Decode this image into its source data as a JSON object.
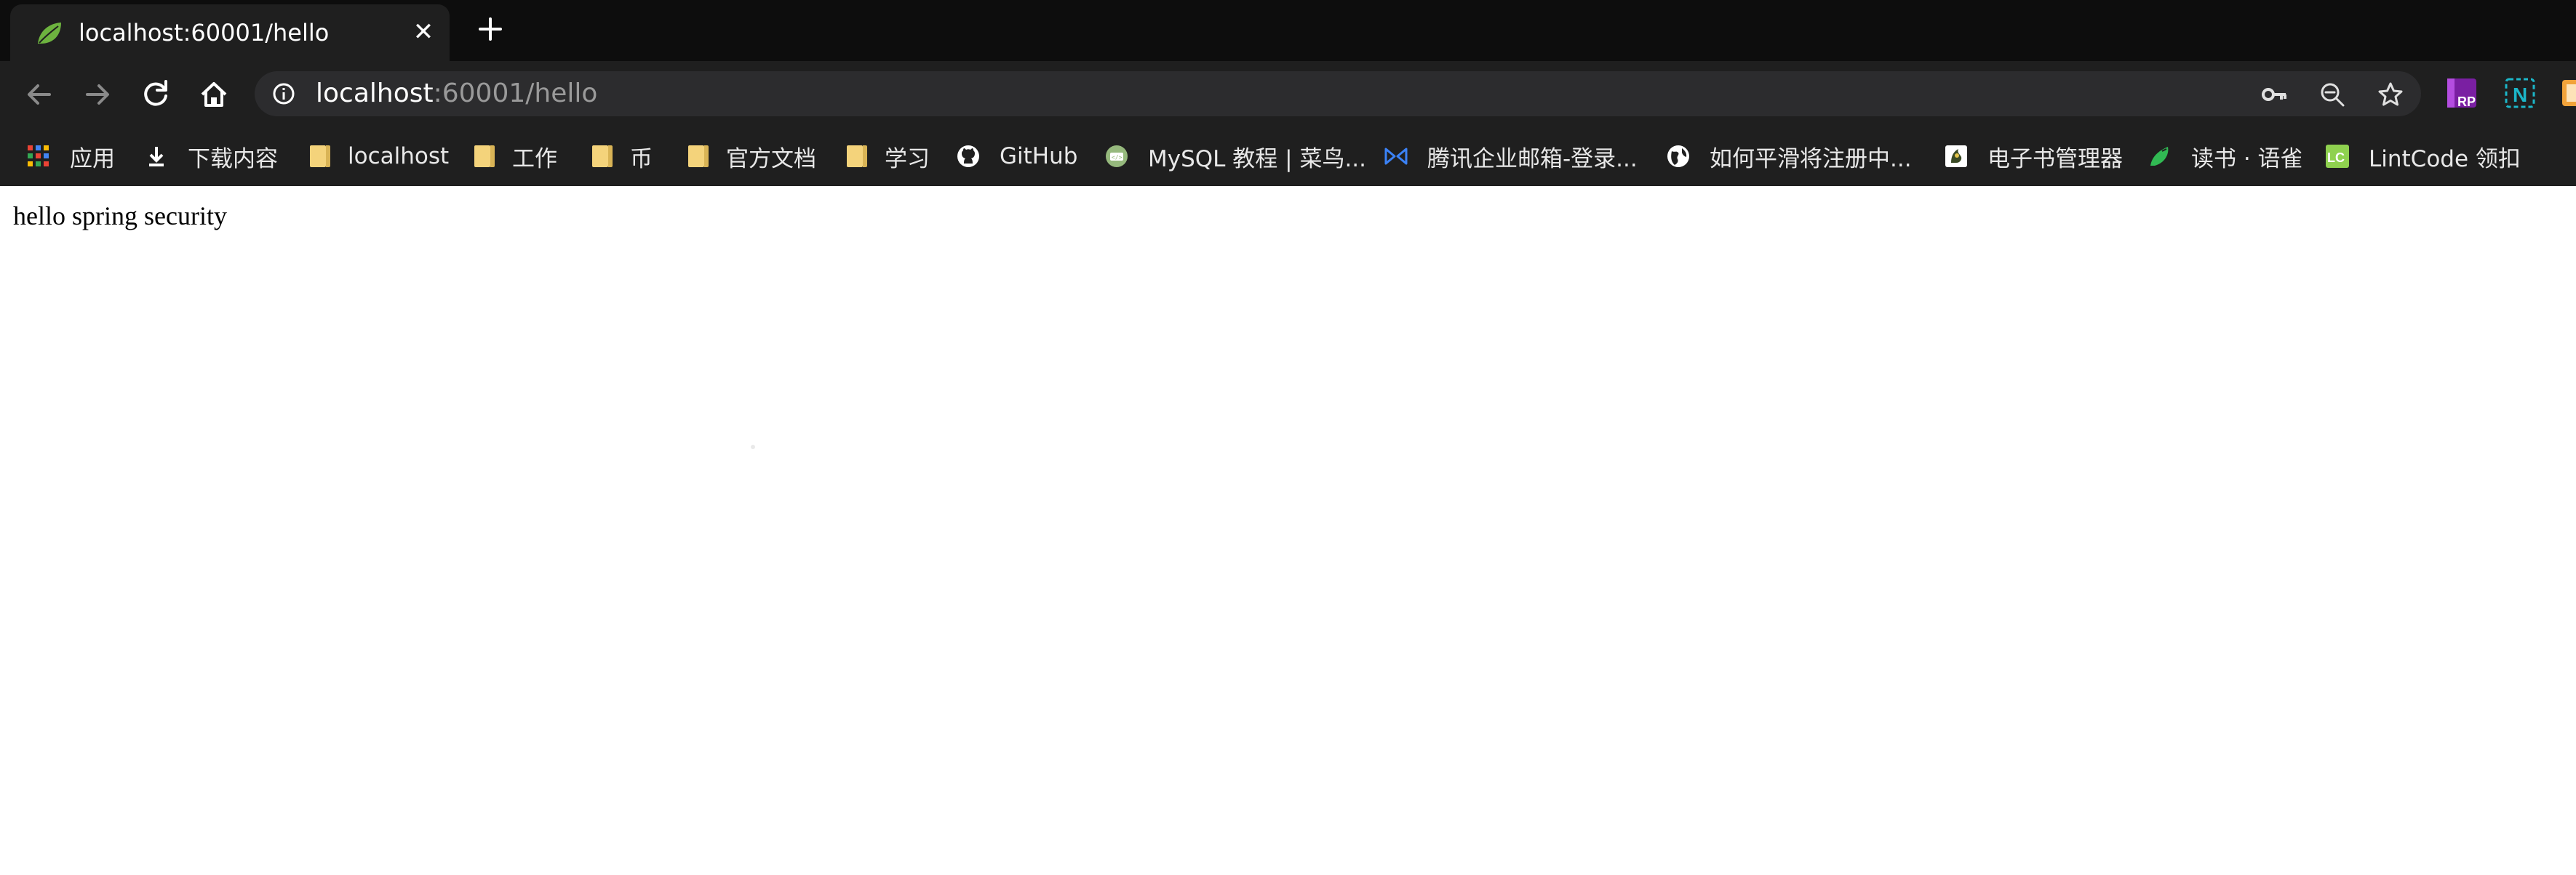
{
  "browser": {
    "tab": {
      "title": "localhost:60001/hello",
      "favicon": "spring-leaf-icon",
      "close_label": "✕",
      "new_tab_icon": "plus-icon"
    },
    "toolbar": {
      "back_icon": "back-arrow-icon",
      "forward_icon": "forward-arrow-icon",
      "reload_icon": "reload-icon",
      "home_icon": "home-icon",
      "url_host": "localhost",
      "url_rest": ":60001/hello",
      "omnibox_icons": [
        "key-icon",
        "zoom-out-icon",
        "star-icon"
      ],
      "extensions": [
        "rp-extension-icon",
        "n-extension-icon",
        "orange-extension-icon"
      ]
    },
    "bookmarks": [
      {
        "label": "应用",
        "icon": "apps-grid-icon"
      },
      {
        "label": "下载内容",
        "icon": "download-icon"
      },
      {
        "label": "localhost",
        "icon": "folder-icon"
      },
      {
        "label": "工作",
        "icon": "folder-icon"
      },
      {
        "label": "币",
        "icon": "folder-icon"
      },
      {
        "label": "官方文档",
        "icon": "folder-icon"
      },
      {
        "label": "学习",
        "icon": "folder-icon"
      },
      {
        "label": "GitHub",
        "icon": "github-icon"
      },
      {
        "label": "MySQL 教程 | 菜鸟...",
        "icon": "runoob-icon"
      },
      {
        "label": "腾讯企业邮箱-登录...",
        "icon": "tencent-mail-icon"
      },
      {
        "label": "如何平滑将注册中...",
        "icon": "globe-icon"
      },
      {
        "label": "电子书管理器",
        "icon": "ebook-icon"
      },
      {
        "label": "读书 · 语雀",
        "icon": "yuque-icon"
      },
      {
        "label": "LintCode 领扣",
        "icon": "lintcode-icon"
      }
    ]
  },
  "page": {
    "body_text": "hello spring security"
  },
  "colors": {
    "tabstrip_bg": "#0d0d0d",
    "toolbar_bg": "#1f1f1f",
    "omnibox_bg": "#2c2c2e",
    "folder": "#f4d37b",
    "spring_green": "#6db33f",
    "page_bg": "#ffffff"
  }
}
